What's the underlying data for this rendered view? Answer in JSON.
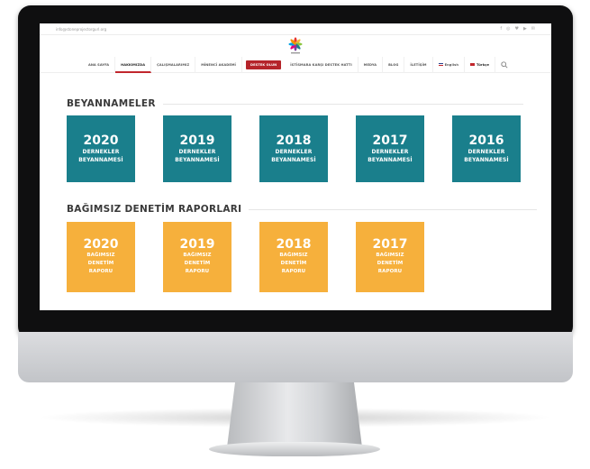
{
  "topbar": {
    "email": "info@stoneprojectorgurl.org",
    "social_icons": [
      "facebook-icon",
      "instagram-icon",
      "twitter-icon",
      "youtube-icon",
      "mail-icon"
    ],
    "social_glyphs": [
      "f",
      "◎",
      "♥",
      "▶",
      "✉"
    ]
  },
  "nav": {
    "items": [
      "ANA SAYFA",
      "HAKKIMIZDA",
      "ÇALIŞMALARIMIZ",
      "MİNENCİ AKADEMİ",
      "DESTEK OLUN",
      "İSTİSMARA KARŞI DESTEK HATTI",
      "MEDYA",
      "BLOG",
      "İLETİŞİM",
      "English",
      "Türkçe"
    ],
    "cta_color": "#b5242a"
  },
  "sections": {
    "declarations": {
      "heading": "BEYANNAMELER",
      "tiles": [
        {
          "year": "2020",
          "line1": "DERNEKLER",
          "line2": "BEYANNAMESİ"
        },
        {
          "year": "2019",
          "line1": "DERNEKLER",
          "line2": "BEYANNAMESİ"
        },
        {
          "year": "2018",
          "line1": "DERNEKLER",
          "line2": "BEYANNAMESİ"
        },
        {
          "year": "2017",
          "line1": "DERNEKLER",
          "line2": "BEYANNAMESİ"
        },
        {
          "year": "2016",
          "line1": "DERNEKLER",
          "line2": "BEYANNAMESİ"
        }
      ],
      "color": "#1a7f8c"
    },
    "audits": {
      "heading": "BAĞIMSIZ DENETİM RAPORLARI",
      "tiles": [
        {
          "year": "2020",
          "line1": "BAĞIMSIZ",
          "line2": "DENETİM",
          "line3": "RAPORU"
        },
        {
          "year": "2019",
          "line1": "BAĞIMSIZ",
          "line2": "DENETİM",
          "line3": "RAPORU"
        },
        {
          "year": "2018",
          "line1": "BAĞIMSIZ",
          "line2": "DENETİM",
          "line3": "RAPORU"
        },
        {
          "year": "2017",
          "line1": "BAĞIMSIZ",
          "line2": "DENETİM",
          "line3": "RAPORU"
        }
      ],
      "color": "#f6b03c"
    }
  }
}
